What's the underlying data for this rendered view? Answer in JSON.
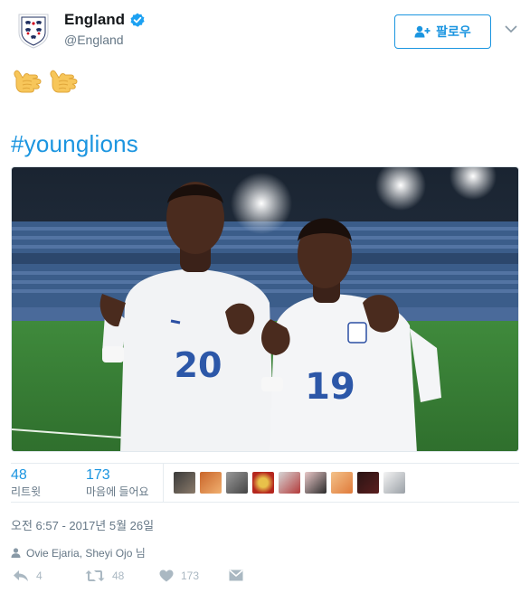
{
  "account": {
    "display_name": "England",
    "handle": "@England",
    "verified": true
  },
  "follow_button": {
    "label": "팔로우"
  },
  "tweet": {
    "emoji": [
      "call-me-hand-emoji",
      "call-me-hand-emoji"
    ],
    "hashtag": "#younglions",
    "photo": {
      "description_icon": "photo",
      "jersey_numbers": [
        "20",
        "19"
      ]
    }
  },
  "stats": {
    "retweets": {
      "count": "48",
      "label": "리트윗"
    },
    "likes": {
      "count": "173",
      "label": "마음에 들어요"
    },
    "liker_avatar_count": 9
  },
  "timestamp": "오전 6:57 - 2017년 5월 26일",
  "tagged": "Ovie Ejaria, Sheyi Ojo 님",
  "actions": {
    "reply": {
      "icon": "reply-icon",
      "count": "4"
    },
    "retweet": {
      "icon": "retweet-icon",
      "count": "48"
    },
    "like": {
      "icon": "heart-icon",
      "count": "173"
    },
    "message": {
      "icon": "envelope-icon"
    }
  },
  "colors": {
    "accent": "#1b95e0",
    "muted": "#657786",
    "action_gray": "#aab8c2",
    "verified": "#1da1f2"
  }
}
